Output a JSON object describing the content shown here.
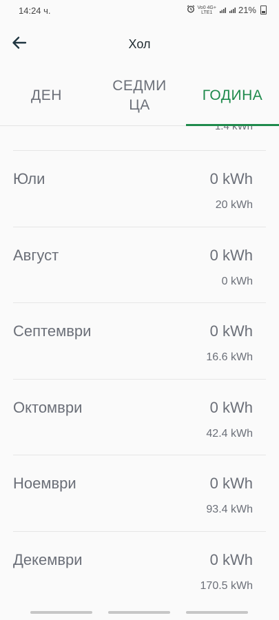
{
  "status": {
    "time": "14:24 ч.",
    "network_top": "Vo0 4G+",
    "network_bottom": "LTE1",
    "battery": "21%"
  },
  "app_bar": {
    "title": "Хол",
    "back_icon": "arrow-left-icon"
  },
  "tabs": [
    {
      "label": "ДЕН",
      "selected": false
    },
    {
      "label": "СЕДМИ ЦА",
      "selected": false
    },
    {
      "label": "ГОДИНА",
      "selected": true
    }
  ],
  "accent_color": "#1f8a4c",
  "partial_row": {
    "previous": "1.4 kWh"
  },
  "months": [
    {
      "name": "Юли",
      "current": "0 kWh",
      "previous": "20 kWh"
    },
    {
      "name": "Август",
      "current": "0 kWh",
      "previous": "0 kWh"
    },
    {
      "name": "Септември",
      "current": "0 kWh",
      "previous": "16.6 kWh"
    },
    {
      "name": "Октомври",
      "current": "0 kWh",
      "previous": "42.4 kWh"
    },
    {
      "name": "Ноември",
      "current": "0 kWh",
      "previous": "93.4 kWh"
    },
    {
      "name": "Декември",
      "current": "0 kWh",
      "previous": "170.5 kWh"
    }
  ]
}
